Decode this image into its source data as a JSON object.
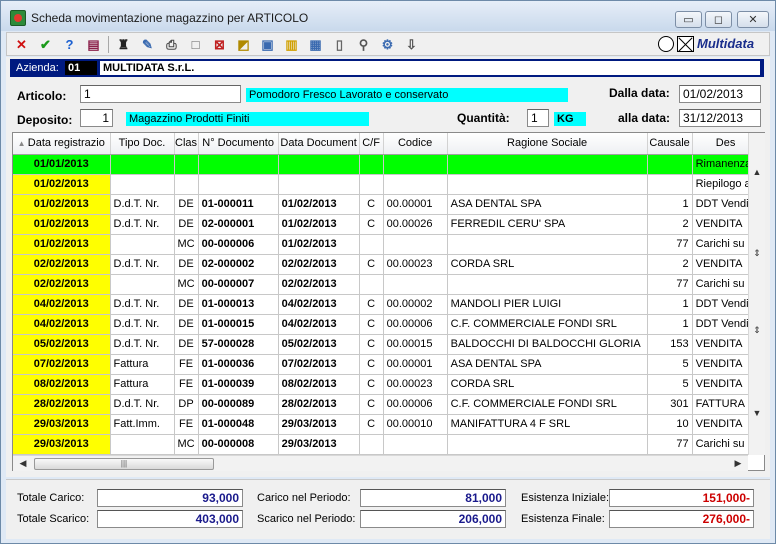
{
  "window": {
    "title": "Scheda movimentazione magazzino per ARTICOLO",
    "minimize": "▭",
    "maximize": "◻",
    "close": "✕"
  },
  "toolbar": {
    "logo": "Multidata"
  },
  "azienda": {
    "label": "Azienda:",
    "code": "01",
    "name": "MULTIDATA S.r.L."
  },
  "articolo": {
    "label": "Articolo:",
    "code": "1",
    "description": "Pomodoro Fresco Lavorato e conservato"
  },
  "deposito": {
    "label": "Deposito:",
    "code": "1",
    "description": "Magazzino Prodotti Finiti"
  },
  "quantita": {
    "label": "Quantità:",
    "value": "1",
    "unit": "KG"
  },
  "dalla_data": {
    "label": "Dalla data:",
    "value": "01/02/2013"
  },
  "alla_data": {
    "label": "alla data:",
    "value": "31/12/2013"
  },
  "grid": {
    "headers": [
      "Data registrazio",
      "Tipo Doc.",
      "Clas",
      "N° Documento",
      "Data Document",
      "C/F",
      "Codice",
      "Ragione Sociale",
      "Causale",
      "Des"
    ],
    "rows": [
      [
        "01/01/2013",
        "",
        "",
        "",
        "",
        "",
        "",
        "",
        "",
        "Rimanenza"
      ],
      [
        "01/02/2013",
        "",
        "",
        "",
        "",
        "",
        "",
        "",
        "",
        "Riepilogo a"
      ],
      [
        "01/02/2013",
        "D.d.T. Nr.",
        "DE",
        "01-000011",
        "01/02/2013",
        "C",
        "00.00001",
        "ASA DENTAL SPA",
        "1",
        "DDT Vendi"
      ],
      [
        "01/02/2013",
        "D.d.T. Nr.",
        "DE",
        "02-000001",
        "01/02/2013",
        "C",
        "00.00026",
        "FERREDIL CERU' SPA",
        "2",
        "VENDITA"
      ],
      [
        "01/02/2013",
        "",
        "MC",
        "00-000006",
        "01/02/2013",
        "",
        "",
        "",
        "77",
        "Carichi su D"
      ],
      [
        "02/02/2013",
        "D.d.T. Nr.",
        "DE",
        "02-000002",
        "02/02/2013",
        "C",
        "00.00023",
        "CORDA SRL",
        "2",
        "VENDITA"
      ],
      [
        "02/02/2013",
        "",
        "MC",
        "00-000007",
        "02/02/2013",
        "",
        "",
        "",
        "77",
        "Carichi su D"
      ],
      [
        "04/02/2013",
        "D.d.T. Nr.",
        "DE",
        "01-000013",
        "04/02/2013",
        "C",
        "00.00002",
        "MANDOLI PIER LUIGI",
        "1",
        "DDT Vendi"
      ],
      [
        "04/02/2013",
        "D.d.T. Nr.",
        "DE",
        "01-000015",
        "04/02/2013",
        "C",
        "00.00006",
        "C.F. COMMERCIALE FONDI SRL",
        "1",
        "DDT Vendi"
      ],
      [
        "05/02/2013",
        "D.d.T. Nr.",
        "DE",
        "57-000028",
        "05/02/2013",
        "C",
        "00.00015",
        "BALDOCCHI DI BALDOCCHI GLORIA",
        "153",
        "VENDITA"
      ],
      [
        "07/02/2013",
        "Fattura",
        "FE",
        "01-000036",
        "07/02/2013",
        "C",
        "00.00001",
        "ASA DENTAL SPA",
        "5",
        "VENDITA"
      ],
      [
        "08/02/2013",
        "Fattura",
        "FE",
        "01-000039",
        "08/02/2013",
        "C",
        "00.00023",
        "CORDA SRL",
        "5",
        "VENDITA"
      ],
      [
        "28/02/2013",
        "D.d.T. Nr.",
        "DP",
        "00-000089",
        "28/02/2013",
        "C",
        "00.00006",
        "C.F. COMMERCIALE FONDI SRL",
        "301",
        "FATTURA"
      ],
      [
        "29/03/2013",
        "Fatt.Imm.",
        "FE",
        "01-000048",
        "29/03/2013",
        "C",
        "00.00010",
        "MANIFATTURA 4 F SRL",
        "10",
        "VENDITA"
      ],
      [
        "29/03/2013",
        "",
        "MC",
        "00-000008",
        "29/03/2013",
        "",
        "",
        "",
        "77",
        "Carichi su D"
      ]
    ]
  },
  "totals": {
    "carico_label": "Totale Carico:",
    "carico": "93,000",
    "scarico_label": "Totale Scarico:",
    "scarico": "403,000",
    "carico_periodo_label": "Carico nel Periodo:",
    "carico_periodo": "81,000",
    "scarico_periodo_label": "Scarico nel Periodo:",
    "scarico_periodo": "206,000",
    "esistenza_iniziale_label": "Esistenza Iniziale:",
    "esistenza_iniziale": "151,000-",
    "esistenza_finale_label": "Esistenza Finale:",
    "esistenza_finale": "276,000-"
  }
}
